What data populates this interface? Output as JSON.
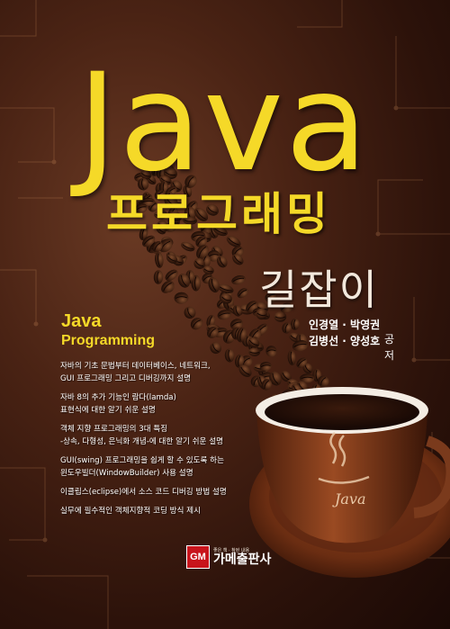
{
  "cover": {
    "title_main": "Java",
    "title_sub": "프로그래밍",
    "title_tag": "길잡이",
    "subtitle_line1": "Java",
    "subtitle_line2": "Programming",
    "authors": {
      "line1": "인경열 · 박영권",
      "line2": "김병선 · 양성호",
      "suffix": "공저"
    },
    "features": [
      [
        "자바의 기초 문법부터 데이터베이스, 네트워크,",
        "GUI 프로그래밍 그리고 디버깅까지 설명"
      ],
      [
        "자바 8의 추가 기능인 람다(lamda)",
        "표현식에 대한 알기 쉬운 설명"
      ],
      [
        "객체 지향 프로그래밍의 3대 특징",
        "-상속, 다형성, 은닉화 개념-에 대한 알기 쉬운 설명"
      ],
      [
        "GUI(swing) 프로그래밍을 쉽게 할 수 있도록 하는",
        "윈도우빌더(WindowBuilder) 사용 설명"
      ],
      [
        "이클립스(eclipse)에서 소스 코드 디버깅 방법 설명"
      ],
      [
        "실무에 필수적인 객체지향적 코딩 방식 제시"
      ]
    ],
    "cup_text": "Java",
    "publisher": {
      "logo": "GM",
      "tagline": "좋은 책 · 참된 내용",
      "name": "가메출판사"
    },
    "colors": {
      "title": "#f5d928",
      "background": "#4a2314",
      "cup": "#7a3a1c"
    }
  }
}
